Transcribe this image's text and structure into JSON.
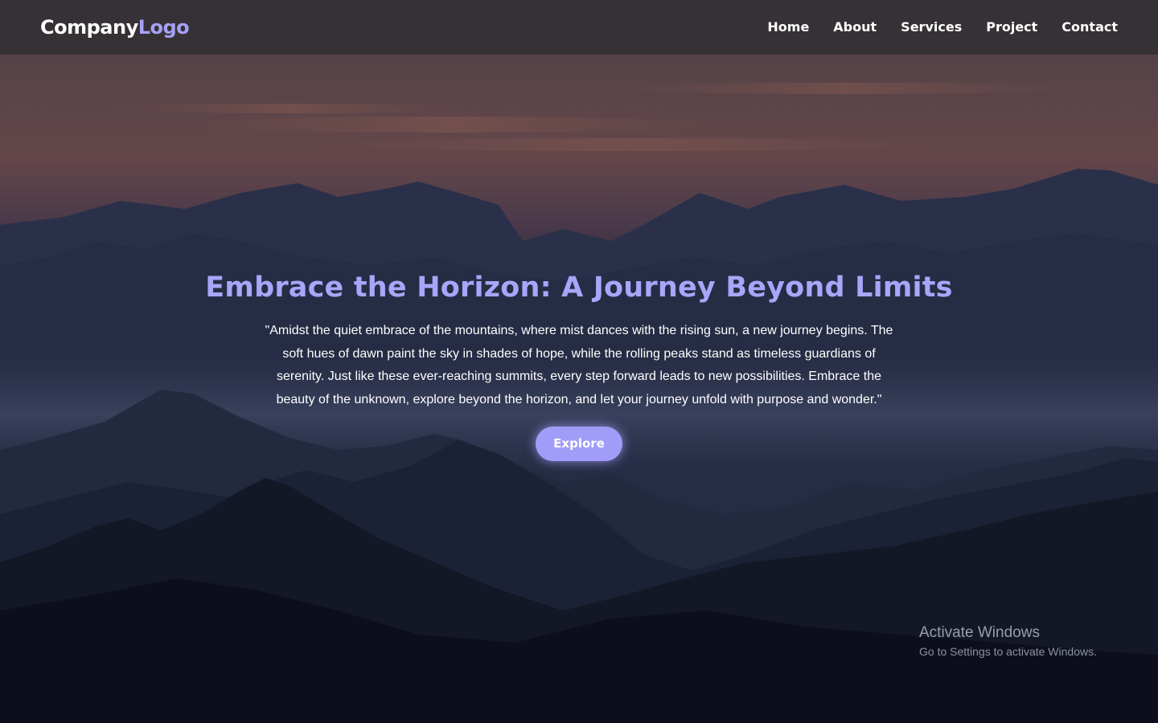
{
  "navbar": {
    "logo": {
      "company": "Company",
      "logo": "Logo"
    },
    "links": [
      {
        "label": "Home"
      },
      {
        "label": "About"
      },
      {
        "label": "Services"
      },
      {
        "label": "Project"
      },
      {
        "label": "Contact"
      }
    ]
  },
  "hero": {
    "title": "Embrace the Horizon: A Journey Beyond Limits",
    "text": "\"Amidst the quiet embrace of the mountains, where mist dances with the rising sun, a new journey begins. The soft hues of dawn paint the sky in shades of hope, while the rolling peaks stand as timeless guardians of serenity. Just like these ever-reaching summits, every step forward leads to new possibilities. Embrace the beauty of the unknown, explore beyond the horizon, and let your journey unfold with purpose and wonder.\"",
    "button_label": "Explore"
  },
  "watermark": {
    "title": "Activate Windows",
    "subtitle": "Go to Settings to activate Windows."
  },
  "colors": {
    "accent": "#a8a5fa",
    "button": "#a19cf7",
    "navbar": "#343034",
    "text": "#ffffff"
  }
}
